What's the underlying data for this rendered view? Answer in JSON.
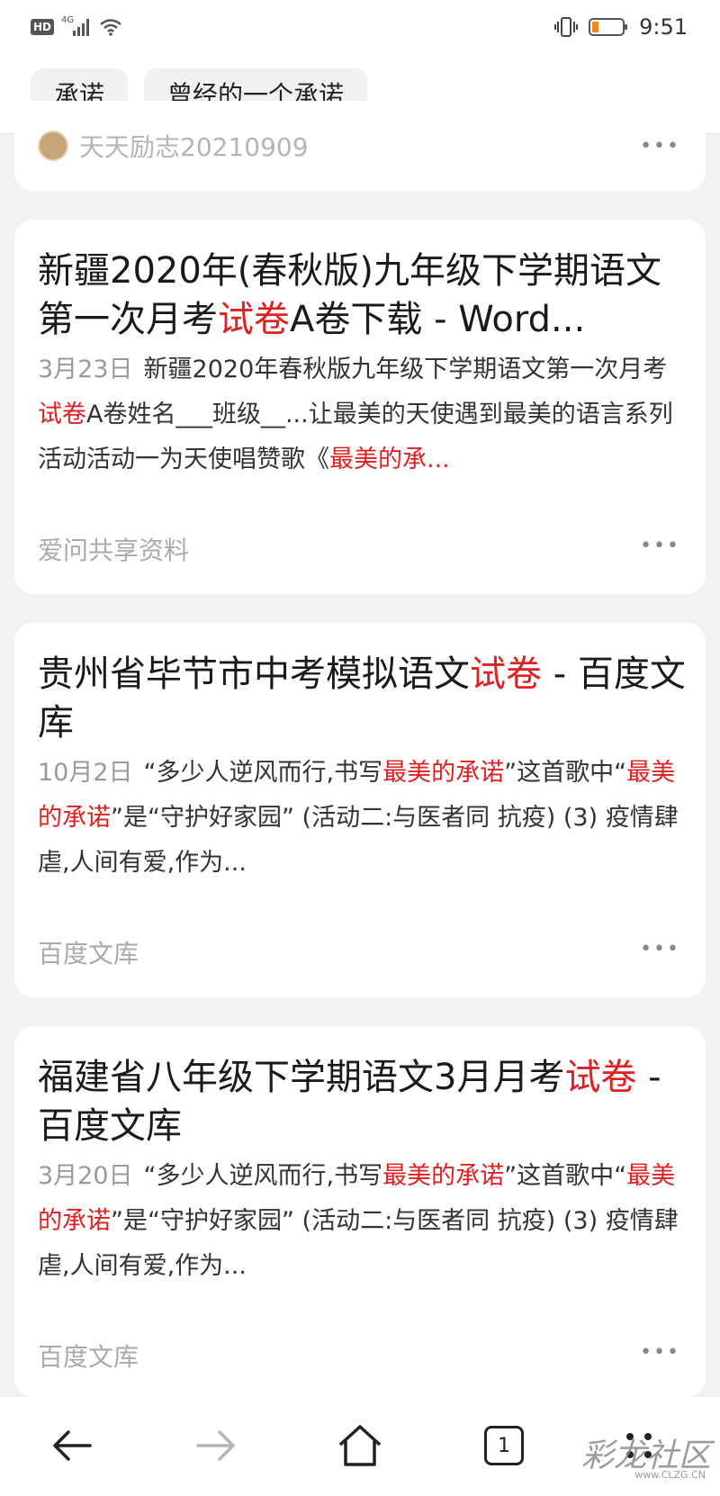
{
  "status_bar": {
    "hd": "HD",
    "network": "4G",
    "time": "9:51",
    "icons": [
      "signal-icon",
      "wifi-icon",
      "vibrate-icon",
      "battery-icon"
    ]
  },
  "tags": [
    "承诺",
    "曾经的一个承诺"
  ],
  "partial_card": {
    "author": "天天励志20210909"
  },
  "results": [
    {
      "title_parts": [
        {
          "text": "新疆2020年(春秋版)九年级下学期语文第一次月考",
          "hl": false
        },
        {
          "text": "试卷",
          "hl": true
        },
        {
          "text": "A卷下载 - Word...",
          "hl": false
        }
      ],
      "date": "3月23日",
      "snippet_parts": [
        {
          "text": "新疆2020年春秋版九年级下学期语文第一次月考",
          "hl": false
        },
        {
          "text": "试卷",
          "hl": true
        },
        {
          "text": "A卷姓名___班级__...让最美的天使遇到最美的语言系列活动活动一为天使唱赞歌《",
          "hl": false
        },
        {
          "text": "最美的承...",
          "hl": true
        }
      ],
      "source": "爱问共享资料"
    },
    {
      "title_parts": [
        {
          "text": "贵州省毕节市中考模拟语文",
          "hl": false
        },
        {
          "text": "试卷",
          "hl": true
        },
        {
          "text": " - 百度文库",
          "hl": false
        }
      ],
      "date": "10月2日",
      "snippet_parts": [
        {
          "text": "“多少人逆风而行,书写",
          "hl": false
        },
        {
          "text": "最美的承诺",
          "hl": true
        },
        {
          "text": "”这首歌中“",
          "hl": false
        },
        {
          "text": "最美的承诺",
          "hl": true
        },
        {
          "text": "”是“守护好家园” (活动二:与医者同 抗疫) (3) 疫情肆虐,人间有爱,作为...",
          "hl": false
        }
      ],
      "source": "百度文库"
    },
    {
      "title_parts": [
        {
          "text": "福建省八年级下学期语文3月月考",
          "hl": false
        },
        {
          "text": "试卷",
          "hl": true
        },
        {
          "text": " - 百度文库",
          "hl": false
        }
      ],
      "date": "3月20日",
      "snippet_parts": [
        {
          "text": "“多少人逆风而行,书写",
          "hl": false
        },
        {
          "text": "最美的承诺",
          "hl": true
        },
        {
          "text": "”这首歌中“",
          "hl": false
        },
        {
          "text": "最美的承诺",
          "hl": true
        },
        {
          "text": "”是“守护好家园” (活动二:与医者同 抗疫) (3) 疫情肆虐,人间有爱,作为...",
          "hl": false
        }
      ],
      "source": "百度文库"
    }
  ],
  "more_label": "•••",
  "bottom_nav": {
    "tab_count": "1",
    "icons": [
      "back-icon",
      "forward-icon",
      "home-icon",
      "tabs-icon",
      "menu-icon"
    ]
  },
  "watermark": {
    "text": "彩龙社区",
    "url": "www.CLZG.CN"
  },
  "colors": {
    "highlight": "#e02020",
    "page_background": "#f2f2f2"
  }
}
